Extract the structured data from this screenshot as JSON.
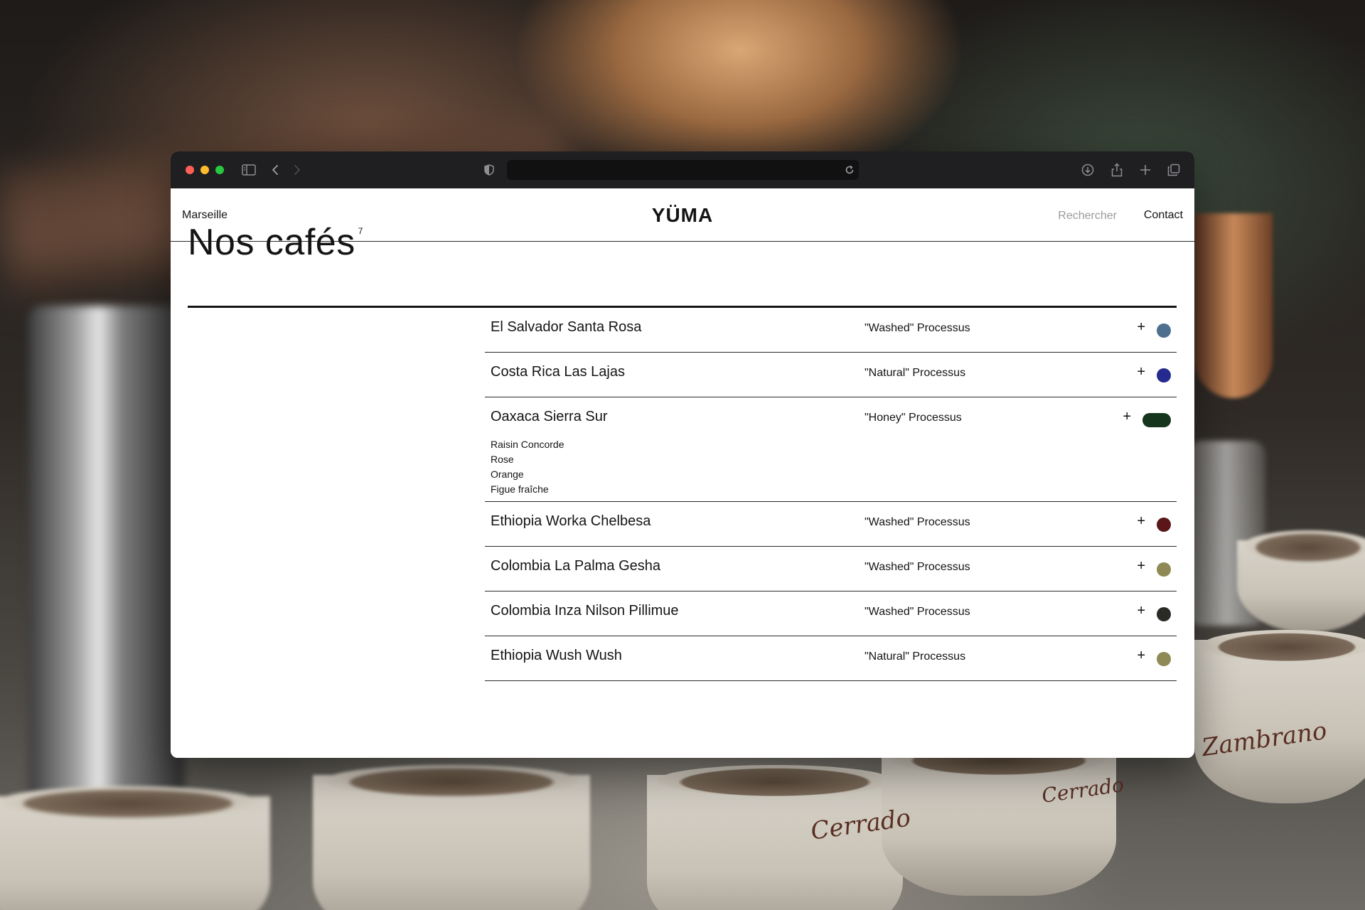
{
  "page": {
    "location": "Marseille",
    "logo": "YÜMA",
    "search_placeholder": "Rechercher",
    "contact": "Contact",
    "heading": "Nos cafés",
    "count": "7"
  },
  "coffees": [
    {
      "name": "El Salvador Santa Rosa",
      "process": "\"Washed\" Processus",
      "plus": "+",
      "color": "#4f6f8f"
    },
    {
      "name": "Costa Rica Las Lajas",
      "process": "\"Natural\" Processus",
      "plus": "+",
      "color": "#242a8e"
    },
    {
      "name": "Oaxaca Sierra Sur",
      "process": "\"Honey\" Processus",
      "plus": "+",
      "color": "#15361c",
      "notes": [
        "Raisin Concorde",
        "Rose",
        "Orange",
        "Figue fraîche"
      ]
    },
    {
      "name": "Ethiopia Worka Chelbesa",
      "process": "\"Washed\" Processus",
      "plus": "+",
      "color": "#5a1618"
    },
    {
      "name": "Colombia La Palma Gesha",
      "process": "\"Washed\" Processus",
      "plus": "+",
      "color": "#8f8a55"
    },
    {
      "name": "Colombia Inza Nilson Pillimue",
      "process": "\"Washed\" Processus",
      "plus": "+",
      "color": "#2a2b27"
    },
    {
      "name": "Ethiopia Wush Wush",
      "process": "\"Natural\" Processus",
      "plus": "+",
      "color": "#8f8a55"
    }
  ],
  "background": {
    "cup_labels": [
      "Zambrano",
      "Cerrado",
      "Cerrado"
    ]
  }
}
